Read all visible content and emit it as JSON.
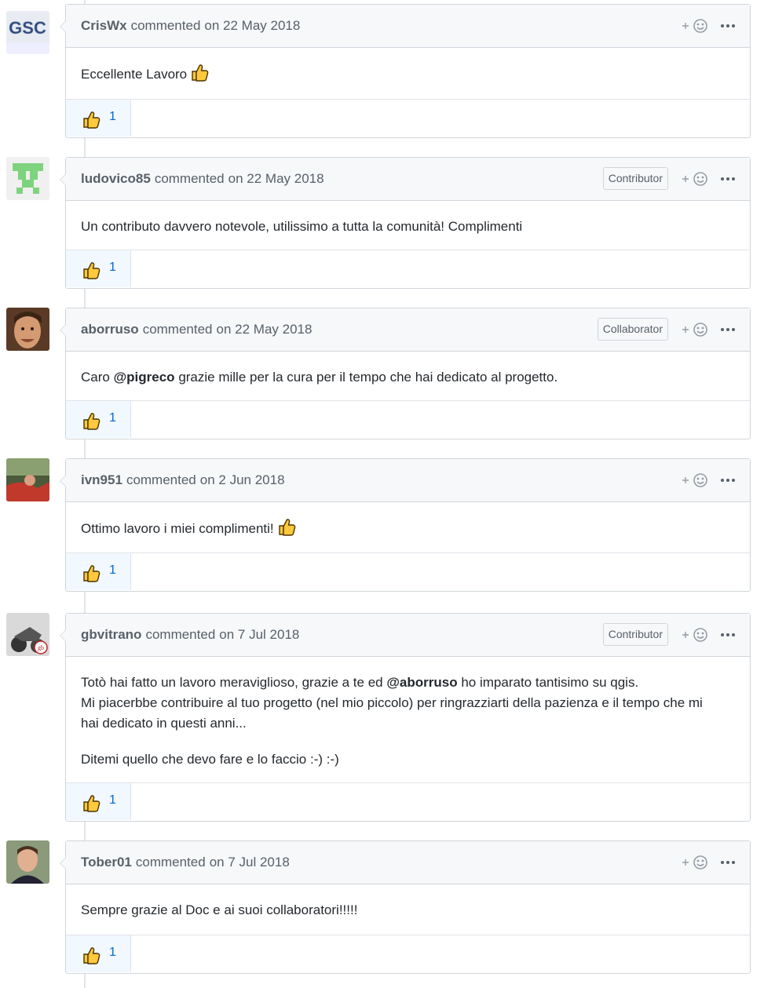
{
  "comments": [
    {
      "author": "CrisWx",
      "action": "commented",
      "date": "on 22 May 2018",
      "badge": "",
      "lines": [
        "Eccellente Lavoro"
      ],
      "reaction_count": "1",
      "avatar": "gsc-logo"
    },
    {
      "author": "ludovico85",
      "action": "commented",
      "date": "on 22 May 2018",
      "badge": "Contributor",
      "lines": [
        "Un contributo davvero notevole, utilissimo a tutta la comunità! Complimenti"
      ],
      "reaction_count": "1",
      "avatar": "identicon-green"
    },
    {
      "author": "aborruso",
      "action": "commented",
      "date": "on 22 May 2018",
      "badge": "Collaborator",
      "lines_pre": "Caro",
      "mention": "@pigreco",
      "lines_post": "grazie mille per la cura per il tempo che hai dedicato al progetto.",
      "reaction_count": "1",
      "avatar": "photo-face"
    },
    {
      "author": "ivn951",
      "action": "commented",
      "date": "on 2 Jun 2018",
      "badge": "",
      "lines": [
        "Ottimo lavoro i miei complimenti!"
      ],
      "reaction_count": "1",
      "avatar": "photo-red"
    },
    {
      "author": "gbvitrano",
      "action": "commented",
      "date": "on 7 Jul 2018",
      "badge": "Contributor",
      "p1_pre": "Totò hai fatto un lavoro meraviglioso, grazie a te ed",
      "p1_mention": "@aborruso",
      "p1_post": "ho imparato tantisimo su qgis.",
      "p1_line2": "Mi piacerbbe contribuire al tuo progetto (nel mio piccolo) per ringrazziarti della pazienza e il tempo che mi",
      "p1_line3": "hai dedicato in questi anni...",
      "p2": "Ditemi quello che devo fare e lo faccio :-) :-)",
      "reaction_count": "1",
      "avatar": "photo-moto"
    },
    {
      "author": "Tober01",
      "action": "commented",
      "date": "on 7 Jul 2018",
      "badge": "",
      "lines": [
        "Sempre grazie al Doc e ai suoi collaboratori!!!!!"
      ],
      "reaction_count": "1",
      "avatar": "photo-man"
    }
  ],
  "avatar_text": {
    "gsc": "GSC"
  },
  "colors": {
    "thumb": "#ffc83d",
    "link": "#0366d6",
    "header_bg": "#f6f8fa"
  }
}
